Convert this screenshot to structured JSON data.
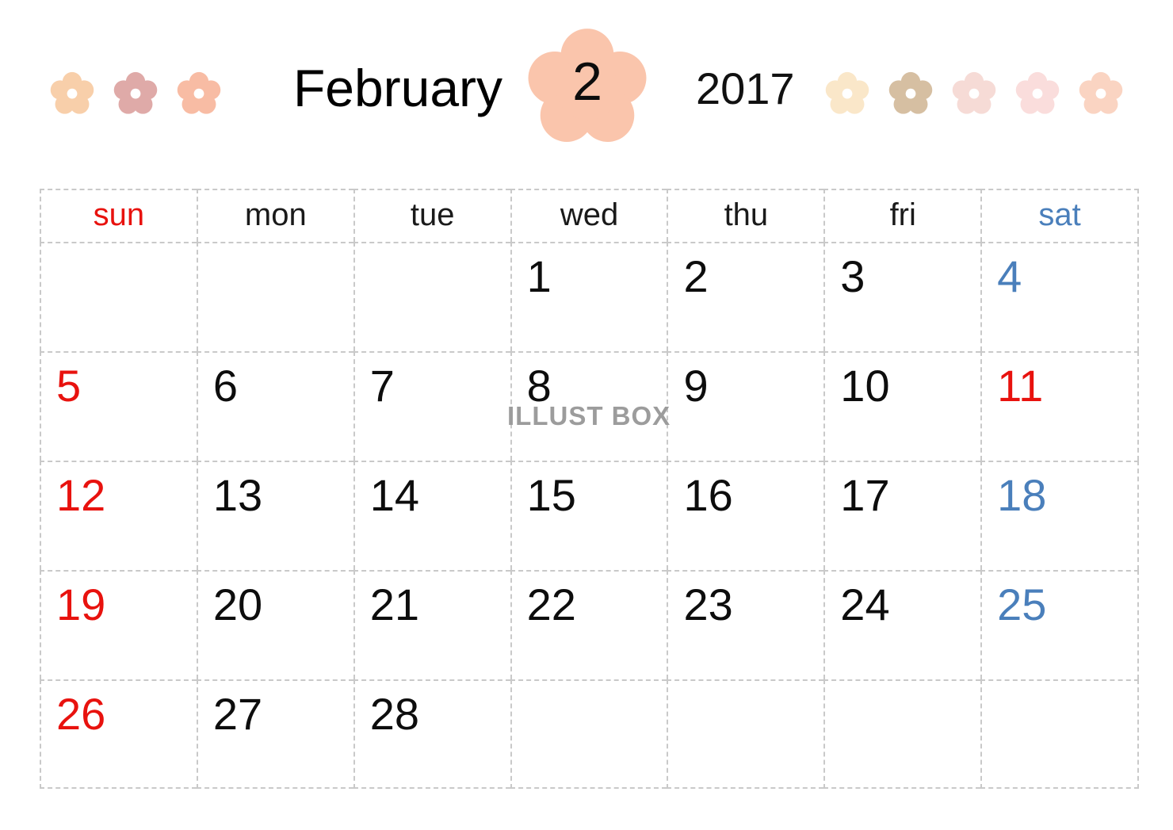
{
  "header": {
    "month_name": "February",
    "month_number": "2",
    "year": "2017",
    "big_flower_color": "#FAC5AC",
    "flowers_left": [
      {
        "name": "flower-left-1",
        "color": "#F8CFAA"
      },
      {
        "name": "flower-left-2",
        "color": "#DFAAA8"
      },
      {
        "name": "flower-left-3",
        "color": "#F8BCA4"
      }
    ],
    "flowers_right": [
      {
        "name": "flower-right-1",
        "color": "#FAE7C9"
      },
      {
        "name": "flower-right-2",
        "color": "#D6BFA2"
      },
      {
        "name": "flower-right-3",
        "color": "#F6DBD6"
      },
      {
        "name": "flower-right-4",
        "color": "#FADDDC"
      },
      {
        "name": "flower-right-5",
        "color": "#FAD4C2"
      }
    ]
  },
  "calendar": {
    "weekday_headers": [
      "sun",
      "mon",
      "tue",
      "wed",
      "thu",
      "fri",
      "sat"
    ],
    "colors": {
      "sunday": "#E8120E",
      "saturday": "#4A7FBB",
      "weekday": "#0D0D0D",
      "grid_line": "#C9C9C9"
    },
    "weeks": [
      [
        "",
        "",
        "",
        "1",
        "2",
        "3",
        "4"
      ],
      [
        "5",
        "6",
        "7",
        "8",
        "9",
        "10",
        "11"
      ],
      [
        "12",
        "13",
        "14",
        "15",
        "16",
        "17",
        "18"
      ],
      [
        "19",
        "20",
        "21",
        "22",
        "23",
        "24",
        "25"
      ],
      [
        "26",
        "27",
        "28",
        "",
        "",
        "",
        ""
      ]
    ]
  },
  "watermark": {
    "text": "ILLUST BOX"
  }
}
